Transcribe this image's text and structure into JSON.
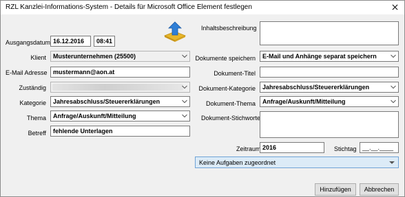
{
  "window": {
    "title": "RZL Kanzlei-Informations-System - Details für Microsoft Office Element festlegen"
  },
  "left": {
    "ausgangsdatum_label": "Ausgangsdatum",
    "ausgangsdatum_date": "16.12.2016",
    "ausgangsdatum_time": "08:41",
    "klient_label": "Klient",
    "klient_value": "Musterunternehmen  (25500)",
    "email_label": "E-Mail Adresse",
    "email_value": "mustermann@aon.at",
    "zustaendig_label": "Zuständig",
    "kategorie_label": "Kategorie",
    "kategorie_value": "Jahresabschluss/Steuererklärungen",
    "thema_label": "Thema",
    "thema_value": "Anfrage/Auskunft/Mitteilung",
    "betreff_label": "Betreff",
    "betreff_value": "fehlende Unterlagen"
  },
  "right": {
    "inhaltsbeschreibung_label": "Inhaltsbeschreibung",
    "dokumente_speichern_label": "Dokumente speichern",
    "dokumente_speichern_value": "E-Mail und Anhänge separat speichern",
    "dokument_titel_label": "Dokument-Titel",
    "dokument_kategorie_label": "Dokument-Kategorie",
    "dokument_kategorie_value": "Jahresabschluss/Steuererklärungen",
    "dokument_thema_label": "Dokument-Thema",
    "dokument_thema_value": "Anfrage/Auskunft/Mitteilung",
    "dokument_stichworte_label": "Dokument-Stichworte",
    "zeitraum_label": "Zeitraum",
    "zeitraum_value": "2016",
    "stichtag_label": "Stichtag",
    "stichtag_value": "__.__.____",
    "aufgaben_value": "Keine Aufgaben zugeordnet"
  },
  "buttons": {
    "hinzufuegen": "Hinzufügen",
    "abbrechen": "Abbrechen"
  },
  "colors": {
    "accent_combo_bg": "#dcebf7",
    "accent_combo_border": "#6fa3d6",
    "window_bg": "#f0f0f0"
  },
  "icons": {
    "close": "close-icon",
    "upload": "upload-arrow-icon",
    "dropdown": "chevron-down-icon"
  }
}
